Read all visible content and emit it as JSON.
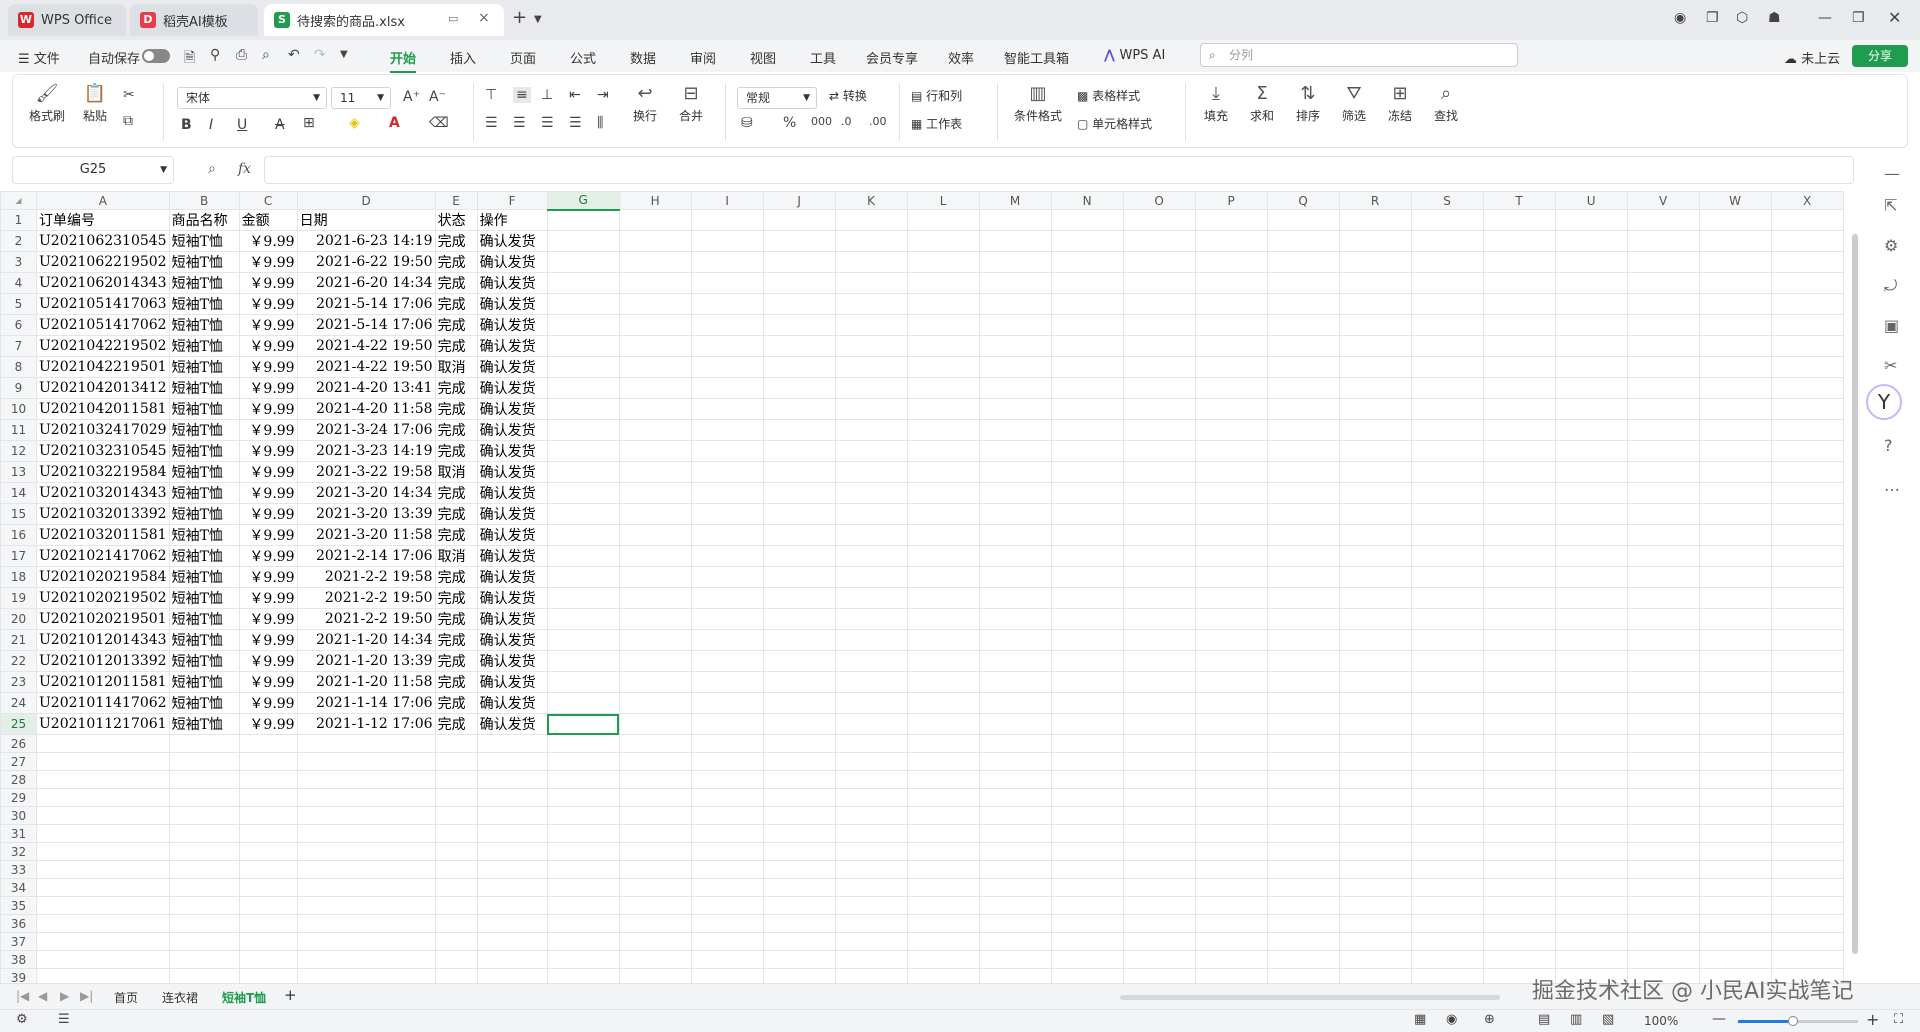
{
  "titlebar": {
    "tabs": [
      {
        "label": "WPS Office",
        "icon": "W",
        "color": "#d9262c"
      },
      {
        "label": "稻壳AI模板",
        "icon": "D",
        "color": "#e53d4c"
      },
      {
        "label": "待搜索的商品.xlsx",
        "icon": "S",
        "color": "#1f9c4e"
      }
    ],
    "new_tab": "+"
  },
  "menubar": {
    "file": "☰ 文件",
    "autosave": "自动保存",
    "items": [
      "开始",
      "插入",
      "页面",
      "公式",
      "数据",
      "审阅",
      "视图",
      "工具",
      "会员专享",
      "效率",
      "智能工具箱",
      "WPS AI"
    ],
    "active": "开始",
    "search_placeholder": "分列",
    "cloud": "未上云",
    "share": "分享"
  },
  "ribbon": {
    "format_painter": "格式刷",
    "paste": "粘贴",
    "font_name": "宋体",
    "font_size": "11",
    "wrap": "换行",
    "merge": "合并",
    "number_format": "常规",
    "convert": "转换",
    "rows_cols": "行和列",
    "worksheet": "工作表",
    "cond_format": "条件格式",
    "table_style": "表格样式",
    "cell_style": "单元格样式",
    "fill": "填充",
    "sum": "求和",
    "sort": "排序",
    "filter": "筛选",
    "freeze": "冻结",
    "find": "查找"
  },
  "formula": {
    "name_box": "G25",
    "fx": "fx",
    "content": ""
  },
  "grid": {
    "columns": [
      "A",
      "B",
      "C",
      "D",
      "E",
      "F",
      "G",
      "H",
      "I",
      "J",
      "K",
      "L",
      "M",
      "N",
      "O",
      "P",
      "Q",
      "R",
      "S",
      "T",
      "U",
      "V",
      "W",
      "X"
    ],
    "selected_col": "G",
    "selected_row": 25,
    "total_rows": 43,
    "rows": [
      [
        "订单编号",
        "商品名称",
        "金额",
        "日期",
        "状态",
        "操作"
      ],
      [
        "U2021062310545",
        "短袖T恤",
        "￥9.99",
        "2021-6-23 14:19",
        "完成",
        "确认发货"
      ],
      [
        "U2021062219502",
        "短袖T恤",
        "￥9.99",
        "2021-6-22 19:50",
        "完成",
        "确认发货"
      ],
      [
        "U2021062014343",
        "短袖T恤",
        "￥9.99",
        "2021-6-20 14:34",
        "完成",
        "确认发货"
      ],
      [
        "U2021051417063",
        "短袖T恤",
        "￥9.99",
        "2021-5-14 17:06",
        "完成",
        "确认发货"
      ],
      [
        "U2021051417062",
        "短袖T恤",
        "￥9.99",
        "2021-5-14 17:06",
        "完成",
        "确认发货"
      ],
      [
        "U2021042219502",
        "短袖T恤",
        "￥9.99",
        "2021-4-22 19:50",
        "完成",
        "确认发货"
      ],
      [
        "U2021042219501",
        "短袖T恤",
        "￥9.99",
        "2021-4-22 19:50",
        "取消",
        "确认发货"
      ],
      [
        "U2021042013412",
        "短袖T恤",
        "￥9.99",
        "2021-4-20 13:41",
        "完成",
        "确认发货"
      ],
      [
        "U2021042011581",
        "短袖T恤",
        "￥9.99",
        "2021-4-20 11:58",
        "完成",
        "确认发货"
      ],
      [
        "U2021032417029",
        "短袖T恤",
        "￥9.99",
        "2021-3-24 17:06",
        "完成",
        "确认发货"
      ],
      [
        "U2021032310545",
        "短袖T恤",
        "￥9.99",
        "2021-3-23 14:19",
        "完成",
        "确认发货"
      ],
      [
        "U2021032219584",
        "短袖T恤",
        "￥9.99",
        "2021-3-22 19:58",
        "取消",
        "确认发货"
      ],
      [
        "U2021032014343",
        "短袖T恤",
        "￥9.99",
        "2021-3-20 14:34",
        "完成",
        "确认发货"
      ],
      [
        "U2021032013392",
        "短袖T恤",
        "￥9.99",
        "2021-3-20 13:39",
        "完成",
        "确认发货"
      ],
      [
        "U2021032011581",
        "短袖T恤",
        "￥9.99",
        "2021-3-20 11:58",
        "完成",
        "确认发货"
      ],
      [
        "U2021021417062",
        "短袖T恤",
        "￥9.99",
        "2021-2-14 17:06",
        "取消",
        "确认发货"
      ],
      [
        "U2021020219584",
        "短袖T恤",
        "￥9.99",
        "2021-2-2 19:58",
        "完成",
        "确认发货"
      ],
      [
        "U2021020219502",
        "短袖T恤",
        "￥9.99",
        "2021-2-2 19:50",
        "完成",
        "确认发货"
      ],
      [
        "U2021020219501",
        "短袖T恤",
        "￥9.99",
        "2021-2-2 19:50",
        "完成",
        "确认发货"
      ],
      [
        "U2021012014343",
        "短袖T恤",
        "￥9.99",
        "2021-1-20 14:34",
        "完成",
        "确认发货"
      ],
      [
        "U2021012013392",
        "短袖T恤",
        "￥9.99",
        "2021-1-20 13:39",
        "完成",
        "确认发货"
      ],
      [
        "U2021012011581",
        "短袖T恤",
        "￥9.99",
        "2021-1-20 11:58",
        "完成",
        "确认发货"
      ],
      [
        "U2021011417062",
        "短袖T恤",
        "￥9.99",
        "2021-1-14 17:06",
        "完成",
        "确认发货"
      ],
      [
        "U2021011217061",
        "短袖T恤",
        "￥9.99",
        "2021-1-12 17:06",
        "完成",
        "确认发货"
      ]
    ]
  },
  "sheet_tabs": {
    "items": [
      "首页",
      "连衣裙",
      "短袖T恤"
    ],
    "active": "短袖T恤",
    "add": "+"
  },
  "statusbar": {
    "zoom": "100%"
  },
  "watermark": "掘金技术社区 @ 小民AI实战笔记",
  "colors": {
    "accent": "#1f9c4e"
  }
}
